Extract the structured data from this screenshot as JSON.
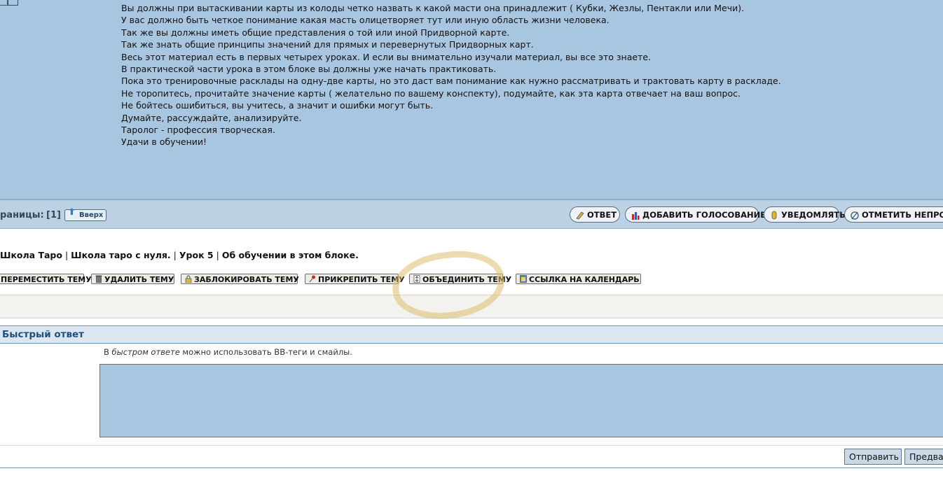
{
  "post": {
    "lines": [
      "Вы должны при вытаскивании карты из колоды четко назвать к какой масти она принадлежит ( Кубки, Жезлы, Пентакли или Мечи).",
      "У вас должно быть  четкое понимание какая  масть олицетворяет тут или иную область жизни человека.",
      "Так же вы должны иметь общие представления о той или иной Придворной карте.",
      "Так же знать общие принципы значений для прямых и перевернутых Придворных карт.",
      "Весь этот материал есть в первых четырех уроках.  И если вы внимательно изучали материал, вы все это знаете.",
      "В практической части урока в этом блоке вы должны уже начать практиковать.",
      "Пока это тренировочные расклады на одну-две карты, но это даст вам понимание как нужно рассматривать и трактовать карту в раскладе.",
      "Не торопитесь, прочитайте значение карты ( желательно по вашему конспекту), подумайте, как эта карта отвечает на ваш вопрос.",
      "Не бойтесь ошибиться, вы учитесь, а значит и ошибки могут быть.",
      "Думайте, рассуждайте, анализируйте.",
      "Таролог - профессия творческая.",
      "Удачи в обучении!"
    ]
  },
  "pagebar": {
    "label": "раницы:",
    "pages": "[1]",
    "top_button": "Вверх",
    "actions": [
      "ОТВЕТ",
      "ДОБАВИТЬ ГОЛОСОВАНИЕ",
      "УВЕДОМЛЯТЬ",
      "ОТМЕТИТЬ НЕПРОЧ"
    ]
  },
  "breadcrumb": [
    "Школа Таро",
    "Школа таро с нуля.",
    "Урок 5",
    "Об обучении в этом блоке."
  ],
  "breadcrumb_sep": "|",
  "moderation": [
    "ПЕРЕМЕСТИТЬ ТЕМУ",
    "УДАЛИТЬ ТЕМУ",
    "ЗАБЛОКИРОВАТЬ ТЕМУ",
    "ПРИКРЕПИТЬ ТЕМУ",
    "ОБЪЕДИНИТЬ ТЕМУ",
    "ССЫЛКА НА КАЛЕНДАРЬ"
  ],
  "quick_reply": {
    "title": "Быстрый ответ",
    "note_prefix": "В ",
    "note_em": "быстром ответе",
    "note_suffix": " можно использовать BB-теги и смайлы.",
    "textarea_value": "",
    "submit_label": "Отправить",
    "preview_label": "Предва"
  },
  "colors": {
    "post_bg": "#a8c6df",
    "bar_bg": "#bcd2e4",
    "highlight": "#dabe6e",
    "title": "#1f5079"
  }
}
